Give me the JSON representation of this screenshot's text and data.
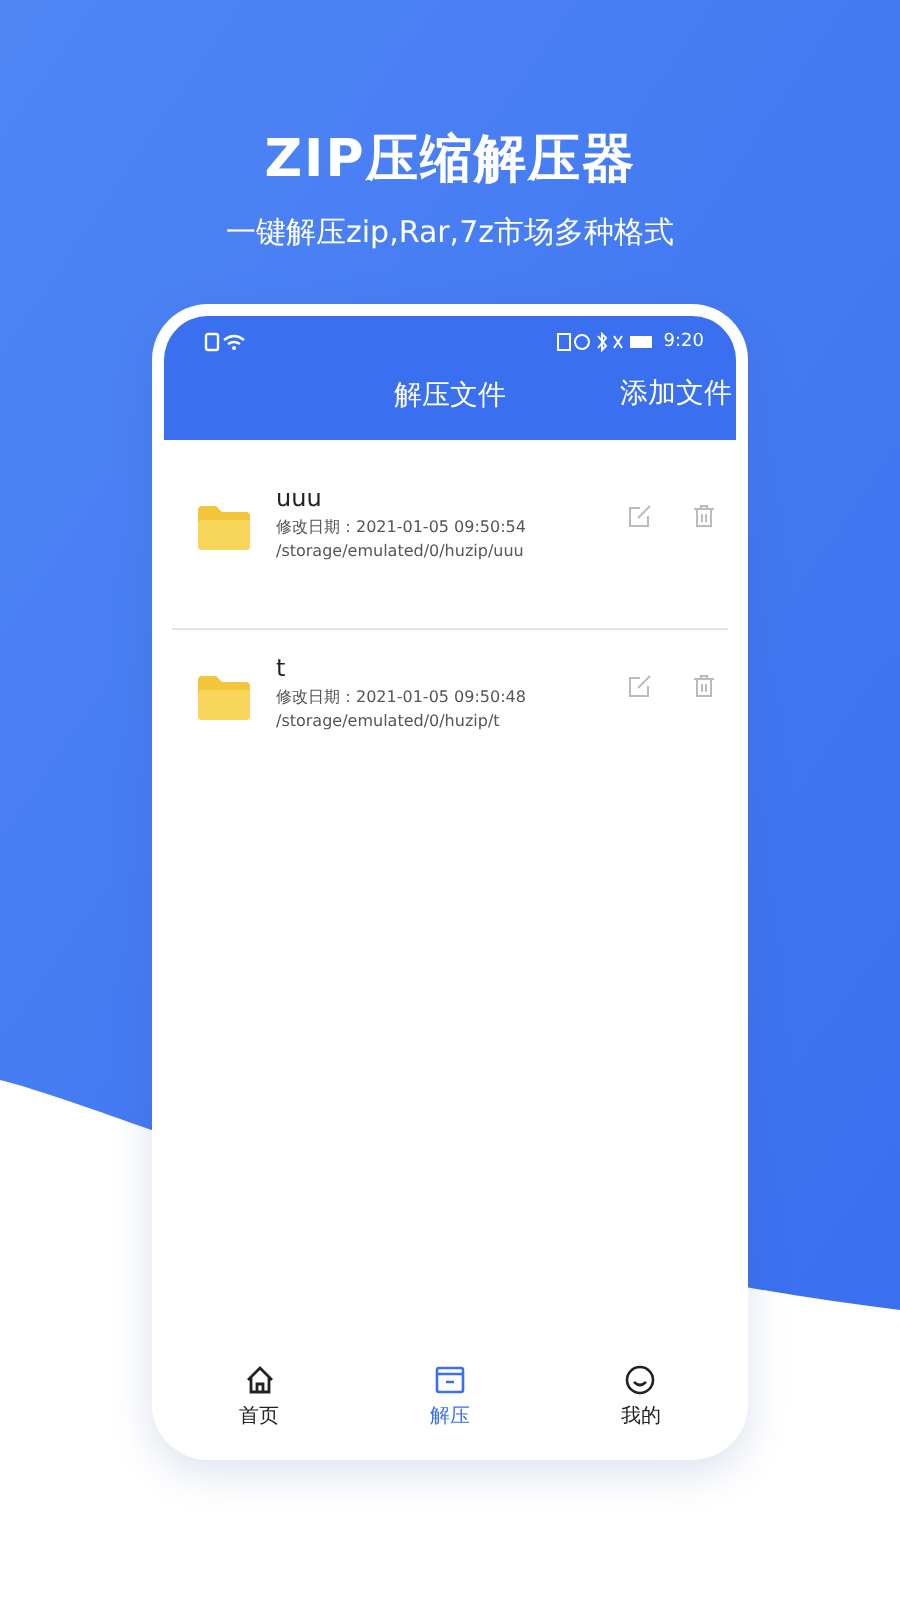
{
  "promo": {
    "title": "ZIP压缩解压器",
    "subtitle": "一键解压zip,Rar,7z市场多种格式"
  },
  "status_bar": {
    "time": "9:20"
  },
  "header": {
    "title": "解压文件",
    "action": "添加文件"
  },
  "files": [
    {
      "name": "uuu",
      "modified": "修改日期：2021-01-05 09:50:54",
      "path": "/storage/emulated/0/huzip/uuu"
    },
    {
      "name": "t",
      "modified": "修改日期：2021-01-05 09:50:48",
      "path": "/storage/emulated/0/huzip/t"
    }
  ],
  "tabs": [
    {
      "label": "首页",
      "kind": "home",
      "selected": false
    },
    {
      "label": "解压",
      "kind": "archive",
      "selected": true
    },
    {
      "label": "我的",
      "kind": "profile",
      "selected": false
    }
  ]
}
